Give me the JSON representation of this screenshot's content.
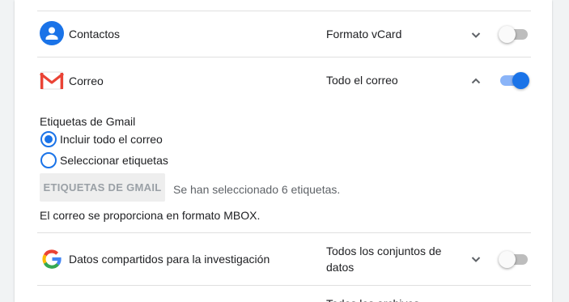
{
  "services": [
    {
      "name": "Contactos",
      "icon": "contacts-icon",
      "format": "Formato vCard",
      "enabled": false,
      "expanded": false
    },
    {
      "name": "Correo",
      "icon": "gmail-icon",
      "format": "Todo el correo",
      "enabled": true,
      "expanded": true,
      "options": {
        "heading": "Etiquetas de Gmail",
        "radio_include_all": "Incluir todo el correo",
        "radio_select_labels": "Seleccionar etiquetas",
        "selected_option": "Incluir todo el correo",
        "labels_button": "ETIQUETAS DE GMAIL",
        "labels_note": "Se han seleccionado 6 etiquetas.",
        "format_note": "El correo se proporciona en formato MBOX."
      }
    },
    {
      "name": "Datos compartidos para la investigación",
      "icon": "google-g-icon",
      "format": "Todos los conjuntos de datos",
      "enabled": false,
      "expanded": false
    },
    {
      "name": "",
      "icon": "",
      "format": "Todos los archivos",
      "enabled": false,
      "expanded": false
    }
  ],
  "colors": {
    "accent": "#1a73e8",
    "accent_light": "#8ab4f8",
    "toggle_off_track": "#bdbdbd",
    "divider": "#e0e0e0",
    "page_background": "#f1f3f4",
    "gmail_red": "#ea4335"
  }
}
